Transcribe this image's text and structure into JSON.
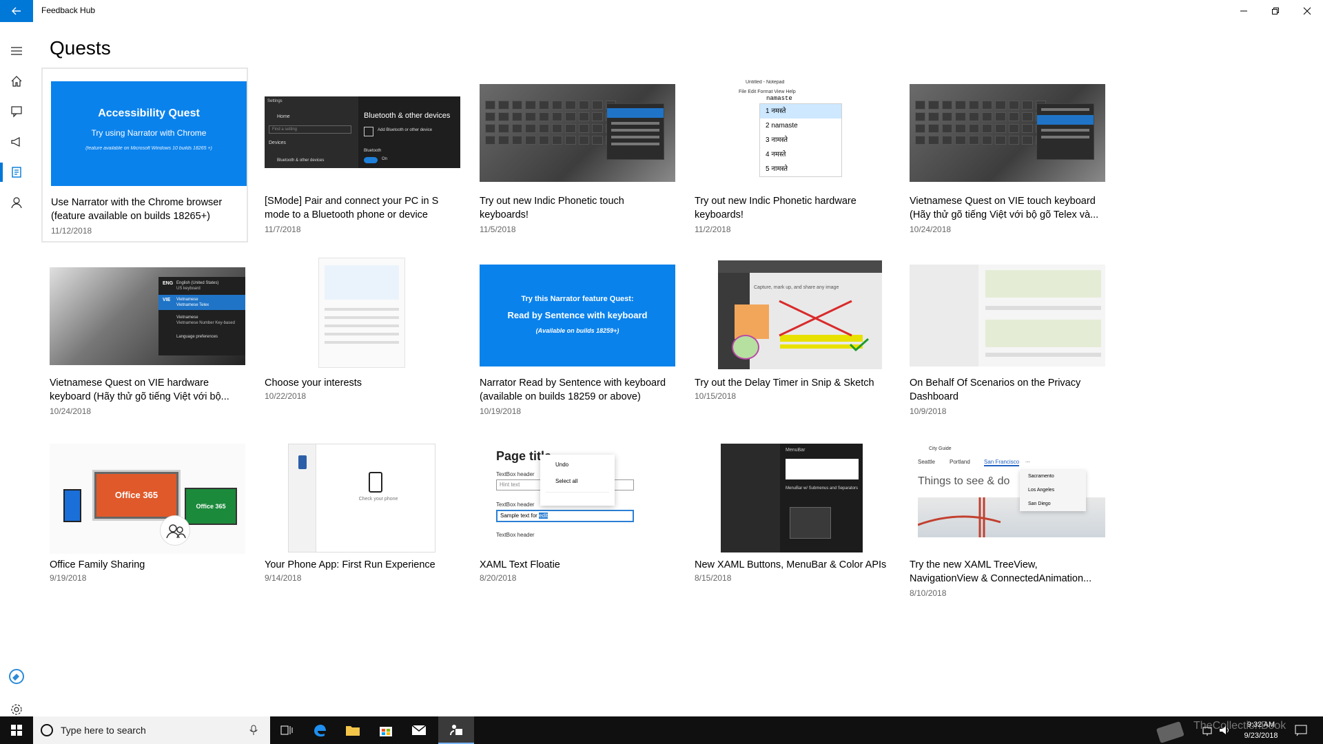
{
  "titlebar": {
    "app_title": "Feedback Hub"
  },
  "page_title": "Quests",
  "quests": [
    {
      "title": "Use Narrator with the Chrome browser (feature available on builds 18265+)",
      "date": "11/12/2018",
      "thumb": {
        "line1": "Accessibility Quest",
        "line2": "Try using Narrator with Chrome",
        "line3": "(feature available on Microsoft Windows 10 builds 18265 +)"
      }
    },
    {
      "title": "[SMode] Pair and connect your PC in S mode to a Bluetooth phone or device",
      "date": "11/7/2018",
      "thumb": {
        "heading": "Bluetooth & other devices",
        "nav_home": "Home",
        "nav_search": "Find a setting",
        "nav_devices": "Devices",
        "nav_item": "Bluetooth & other devices",
        "add": "Add Bluetooth or other device",
        "bt_label": "Bluetooth",
        "bt_state": "On",
        "settings": "Settings"
      }
    },
    {
      "title": "Try out new Indic Phonetic touch keyboards!",
      "date": "11/5/2018"
    },
    {
      "title": "Try out new Indic Phonetic hardware keyboards!",
      "date": "11/2/2018",
      "thumb": {
        "window": "Untitled - Notepad",
        "menu": "File  Edit  Format  View  Help",
        "typed": "namaste",
        "candidates": [
          "1  नमस्ते",
          "2  namaste",
          "3  नामस्ते",
          "4  नमस्ते",
          "5  नामस्ते"
        ]
      }
    },
    {
      "title": "Vietnamese Quest on VIE touch keyboard (Hãy thử gõ tiếng Việt với bộ gõ Telex và...",
      "date": "10/24/2018"
    },
    {
      "title": "Vietnamese Quest on VIE hardware keyboard (Hãy thử gõ tiếng Việt với bộ...",
      "date": "10/24/2018",
      "thumb": {
        "eng": "ENG",
        "eng_desc": "English (United States)",
        "eng_sub": "US keyboard",
        "vie": "VIE",
        "vie_desc": "Vietnamese",
        "vie_sub": "Vietnamese Telex",
        "vie2_desc": "Vietnamese",
        "vie2_sub": "Vietnamese Number Key-based",
        "prefs": "Language preferences"
      }
    },
    {
      "title": "Choose your interests",
      "date": "10/22/2018"
    },
    {
      "title": "Narrator Read by Sentence with keyboard (available on builds 18259 or above)",
      "date": "10/19/2018",
      "thumb": {
        "line1": "Try this Narrator feature Quest:",
        "line2": "Read by Sentence with keyboard",
        "line3": "(Available on builds 18259+)"
      }
    },
    {
      "title": "Try out the Delay Timer in Snip & Sketch",
      "date": "10/15/2018",
      "thumb": {
        "caption": "Capture, mark up, and share any image"
      }
    },
    {
      "title": "On Behalf Of Scenarios on the Privacy Dashboard",
      "date": "10/9/2018"
    },
    {
      "title": "Office Family Sharing",
      "date": "9/19/2018",
      "thumb": {
        "label1": "Office 365",
        "label2": "Office 365"
      }
    },
    {
      "title": "Your Phone App: First Run Experience",
      "date": "9/14/2018",
      "thumb": {
        "caption": "Check your phone"
      }
    },
    {
      "title": "XAML Text Floatie",
      "date": "8/20/2018",
      "thumb": {
        "heading": "Page title",
        "undo": "Undo",
        "select_all": "Select all",
        "hdr1": "TextBox header",
        "hint": "Hint text",
        "hdr2": "TextBox header",
        "sample": "Sample text for",
        "sample_sel": "edit",
        "hdr3": "TextBox header"
      }
    },
    {
      "title": "New XAML Buttons, MenuBar & Color APIs",
      "date": "8/15/2018",
      "thumb": {
        "menubar": "MenuBar",
        "desc": "MenuBar w/ Submenus and Separators"
      }
    },
    {
      "title": "Try the new XAML TreeView, NavigationView & ConnectedAnimation...",
      "date": "8/10/2018",
      "thumb": {
        "app": "City Guide",
        "tabs": [
          "Seattle",
          "Portland",
          "San Francisco"
        ],
        "more": "...",
        "headline": "Things to see & do",
        "menu": [
          "Sacramento",
          "Los Angeles",
          "San Diego"
        ]
      }
    }
  ],
  "taskbar": {
    "search_placeholder": "Type here to search",
    "time": "9:32 AM",
    "date": "9/23/2018"
  },
  "watermark": "TheCollectionBook",
  "colors": {
    "accent": "#0078d7",
    "quest_blue": "#0a82ec",
    "taskbar": "#101010"
  }
}
